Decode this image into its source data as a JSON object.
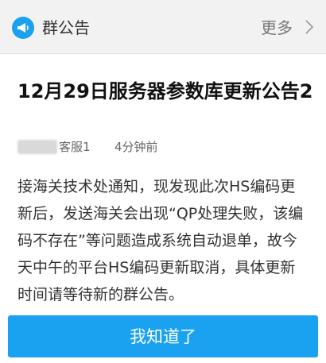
{
  "header": {
    "title": "群公告",
    "more_label": "更多"
  },
  "notice": {
    "title": "12月29日服务器参数库更新公告2",
    "author": "客服1",
    "time": "4分钟前",
    "body": "接海关技术处通知，现发现此次HS编码更\n新后，发送海关会出现“QP处理失败，该编\n码不存在”等问题造成系统自动退单，故今\n天中午的平台HS编码更新取消，具体更新\n时间请等待新的群公告。"
  },
  "action": {
    "ack_label": "我知道了"
  },
  "colors": {
    "accent": "#1aa1f0",
    "header_bg": "#f2f2f2"
  },
  "icons": {
    "header_icon": "megaphone-icon",
    "more_chevron": "chevron-right-icon"
  }
}
